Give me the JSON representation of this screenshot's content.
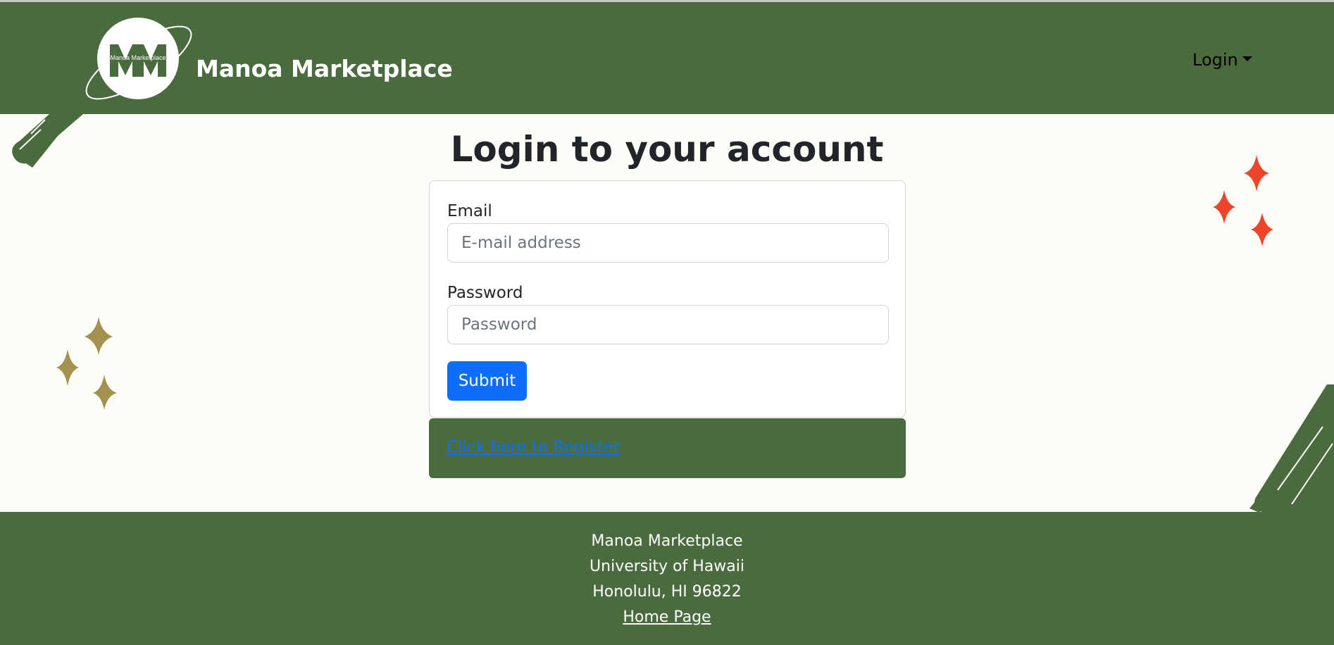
{
  "header": {
    "logo_text": "Manoa Marketplace",
    "brand_name": "Manoa Marketplace",
    "login_menu": "Login"
  },
  "main": {
    "title": "Login to your account",
    "email_label": "Email",
    "email_placeholder": "E-mail address",
    "password_label": "Password",
    "password_placeholder": "Password",
    "submit_label": "Submit",
    "register_link": "Click here to Register"
  },
  "footer": {
    "line1": "Manoa Marketplace",
    "line2": "University of Hawaii",
    "line3": "Honolulu, HI 96822",
    "home_link": "Home Page"
  },
  "colors": {
    "brand_green": "#4a6b3e",
    "background": "#fdfdf8",
    "primary_blue": "#0d6efd",
    "sparkle_red": "#f0442a",
    "sparkle_gold": "#a3924f"
  }
}
